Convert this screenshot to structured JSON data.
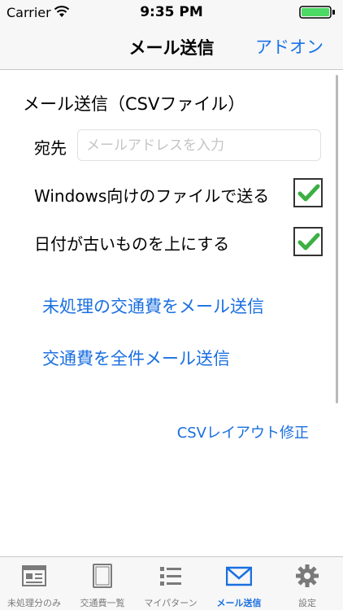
{
  "status_bar": {
    "carrier": "Carrier",
    "time": "9:35 PM"
  },
  "nav": {
    "title": "メール送信",
    "addon": "アドオン"
  },
  "form": {
    "section_title": "メール送信（CSVファイル）",
    "to_label": "宛先",
    "email_placeholder": "メールアドレスを入力",
    "email_value": "",
    "option_windows": "Windows向けのファイルで送る",
    "option_windows_checked": true,
    "option_oldest_first": "日付が古いものを上にする",
    "option_oldest_first_checked": true
  },
  "actions": {
    "send_unprocessed": "未処理の交通費をメール送信",
    "send_all": "交通費を全件メール送信",
    "csv_layout": "CSVレイアウト修正"
  },
  "tabs": [
    {
      "label": "未処理分のみ",
      "icon": "window-icon"
    },
    {
      "label": "交通費一覧",
      "icon": "document-icon"
    },
    {
      "label": "マイパターン",
      "icon": "list-icon"
    },
    {
      "label": "メール送信",
      "icon": "mail-icon"
    },
    {
      "label": "設定",
      "icon": "gear-icon"
    }
  ],
  "active_tab": "メール送信",
  "colors": {
    "accent": "#1a6fe0",
    "check": "#3cb043",
    "tab_inactive": "#7a7a7a"
  }
}
